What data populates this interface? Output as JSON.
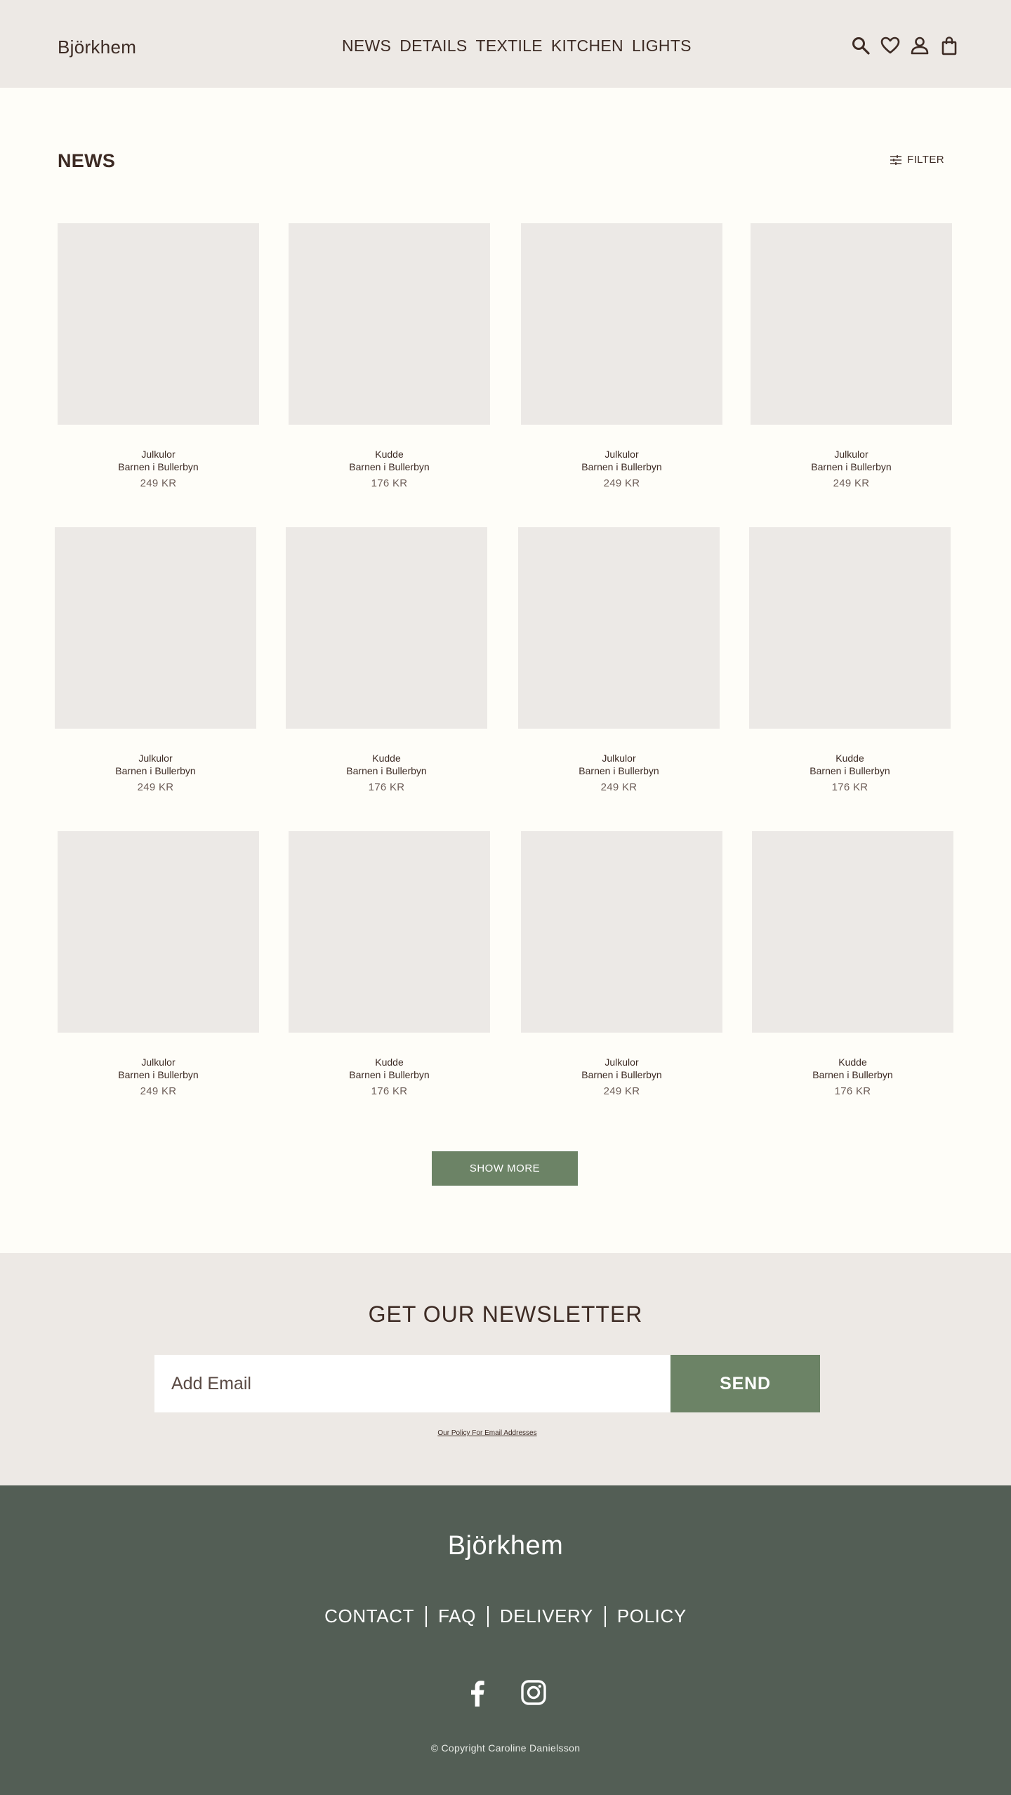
{
  "header": {
    "logo": "Björkhem",
    "nav": [
      "NEWS",
      "DETAILS",
      "TEXTILE",
      "KITCHEN",
      "LIGHTS"
    ],
    "icons": [
      "search-icon",
      "heart-icon",
      "user-icon",
      "bag-icon"
    ]
  },
  "main": {
    "title": "NEWS",
    "filter_label": "FILTER",
    "products": [
      {
        "name": "Julkulor",
        "subtitle": "Barnen i Bullerbyn",
        "price": "249 KR"
      },
      {
        "name": "Kudde",
        "subtitle": "Barnen i Bullerbyn",
        "price": "176 KR"
      },
      {
        "name": "Julkulor",
        "subtitle": "Barnen i Bullerbyn",
        "price": "249 KR"
      },
      {
        "name": "Julkulor",
        "subtitle": "Barnen i Bullerbyn",
        "price": "249 KR"
      },
      {
        "name": "Julkulor",
        "subtitle": "Barnen i Bullerbyn",
        "price": "249 KR"
      },
      {
        "name": "Kudde",
        "subtitle": "Barnen i Bullerbyn",
        "price": "176 KR"
      },
      {
        "name": "Julkulor",
        "subtitle": "Barnen i Bullerbyn",
        "price": "249 KR"
      },
      {
        "name": "Kudde",
        "subtitle": "Barnen i Bullerbyn",
        "price": "176 KR"
      },
      {
        "name": "Julkulor",
        "subtitle": "Barnen i Bullerbyn",
        "price": "249 KR"
      },
      {
        "name": "Kudde",
        "subtitle": "Barnen i Bullerbyn",
        "price": "176 KR"
      },
      {
        "name": "Julkulor",
        "subtitle": "Barnen i Bullerbyn",
        "price": "249 KR"
      },
      {
        "name": "Kudde",
        "subtitle": "Barnen i Bullerbyn",
        "price": "176 KR"
      }
    ],
    "show_more_label": "SHOW MORE"
  },
  "newsletter": {
    "title": "GET OUR NEWSLETTER",
    "email_placeholder": "Add Email",
    "send_label": "SEND",
    "policy_link": "Our Policy For Email Addresses"
  },
  "footer": {
    "logo": "Björkhem",
    "links": [
      "CONTACT",
      "FAQ",
      "DELIVERY",
      "POLICY"
    ],
    "social": [
      "facebook-icon",
      "instagram-icon"
    ],
    "copyright": "© Copyright Caroline Danielsson"
  },
  "colors": {
    "header_bg": "#ede9e5",
    "page_bg": "#fefdf8",
    "accent_green": "#6c8366",
    "footer_bg": "#535e55",
    "text_dark": "#3d2b24"
  }
}
